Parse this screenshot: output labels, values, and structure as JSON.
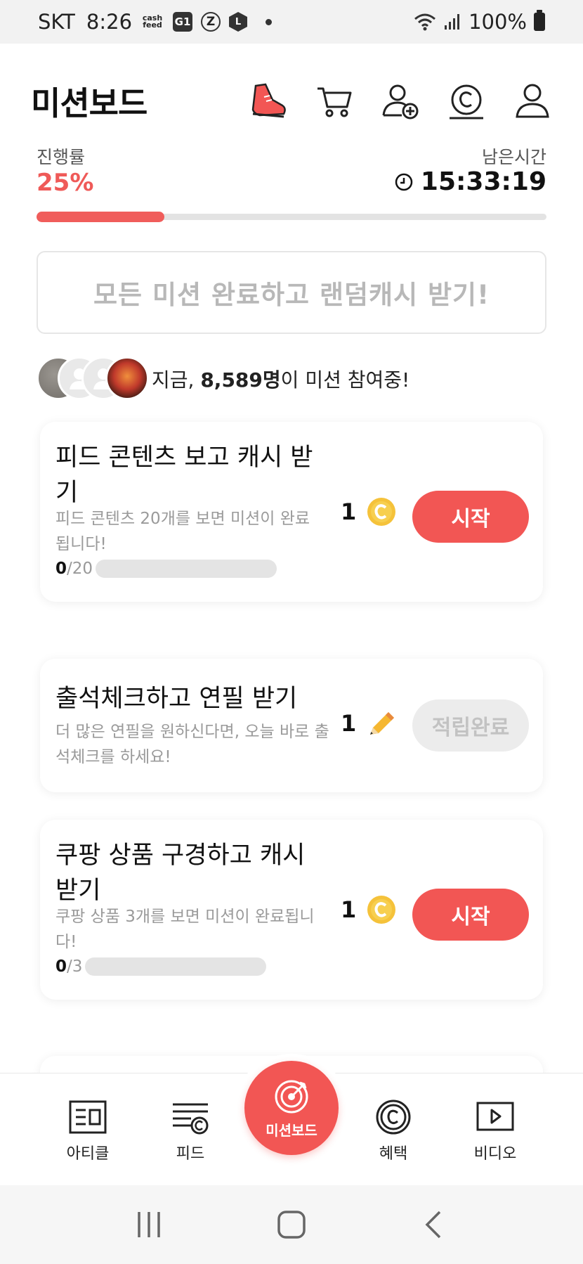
{
  "status_bar": {
    "carrier": "SKT",
    "time": "8:26",
    "cash_feed_icon": "cash\nfeed",
    "g1_icon": "G1",
    "z_icon": "Z",
    "l_icon": "L",
    "battery": "100%"
  },
  "header": {
    "title": "미션보드"
  },
  "progress": {
    "label": "진행률",
    "value": "25%",
    "percent": 25,
    "remaining_label": "남은시간",
    "remaining_value": "15:33:19"
  },
  "random_cash": {
    "label": "모든 미션 완료하고 랜덤캐시 받기!"
  },
  "participants": {
    "prefix": "지금, ",
    "count": "8,589명",
    "suffix": "이 미션 참여중!"
  },
  "missions": [
    {
      "title": "피드 콘텐츠 보고 캐시 받기",
      "desc": "피드 콘텐츠 20개를 보면 미션이 완료됩니다!",
      "current": "0",
      "total": "/20",
      "reward": "1",
      "reward_icon": "coin-icon",
      "button": "시작"
    },
    {
      "title": "출석체크하고 연필 받기",
      "desc": "더 많은 연필을 원하신다면, 오늘 바로 출석체크를 하세요!",
      "reward": "1",
      "reward_icon": "pencil-icon",
      "button": "적립완료"
    },
    {
      "title": "쿠팡 상품 구경하고 캐시받기",
      "desc": "쿠팡 상품 3개를 보면 미션이 완료됩니다!",
      "current": "0",
      "total": "/3",
      "reward": "1",
      "reward_icon": "coin-icon",
      "button": "시작"
    }
  ],
  "bottom_nav": {
    "article": "아티클",
    "feed": "피드",
    "missionboard": "미션보드",
    "benefit": "혜택",
    "video": "비디오"
  },
  "colors": {
    "accent": "#f25654",
    "progress": "#ef5a58",
    "muted": "#9a9a9a"
  }
}
